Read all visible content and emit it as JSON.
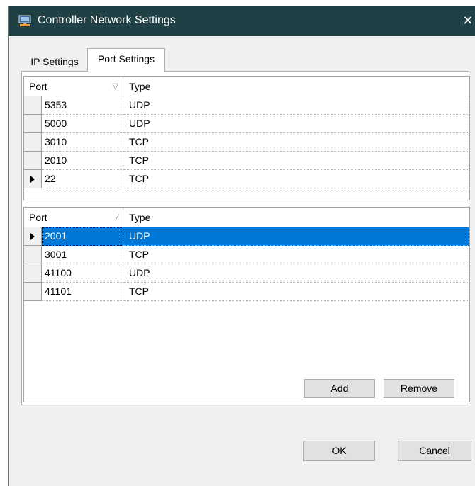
{
  "window": {
    "title": "Controller Network Settings",
    "close_glyph": "✕",
    "icon": "monitor-network-icon"
  },
  "tabs": [
    {
      "label": "IP Settings",
      "active": false
    },
    {
      "label": "Port Settings",
      "active": true
    }
  ],
  "top_grid": {
    "columns": {
      "port": "Port",
      "type": "Type"
    },
    "sort_glyph": "▽",
    "rows": [
      {
        "port": "5353",
        "type": "UDP",
        "current": false
      },
      {
        "port": "5000",
        "type": "UDP",
        "current": false
      },
      {
        "port": "3010",
        "type": "TCP",
        "current": false
      },
      {
        "port": "2010",
        "type": "TCP",
        "current": false
      },
      {
        "port": "22",
        "type": "TCP",
        "current": true
      }
    ]
  },
  "bottom_grid": {
    "columns": {
      "port": "Port",
      "type": "Type"
    },
    "sort_glyph": "⁄",
    "rows": [
      {
        "port": "2001",
        "type": "UDP",
        "current": true,
        "selected": true
      },
      {
        "port": "3001",
        "type": "TCP",
        "current": false,
        "selected": false
      },
      {
        "port": "41100",
        "type": "UDP",
        "current": false,
        "selected": false
      },
      {
        "port": "41101",
        "type": "TCP",
        "current": false,
        "selected": false
      }
    ]
  },
  "buttons": {
    "add": "Add",
    "remove": "Remove",
    "ok": "OK",
    "cancel": "Cancel"
  },
  "colors": {
    "titlebar": "#1f4146",
    "selection": "#0078d7",
    "dialog_bg": "#f0f0f0"
  }
}
